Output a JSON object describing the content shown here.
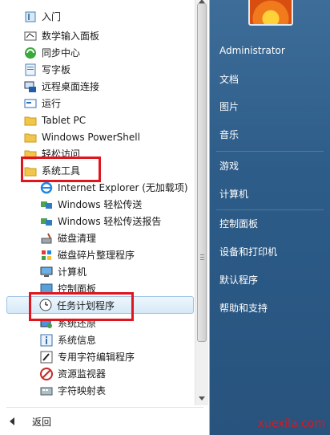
{
  "programs": [
    {
      "label": "入门",
      "icon": "getting-started-icon"
    },
    {
      "label": "数学输入面板",
      "icon": "math-input-icon"
    },
    {
      "label": "同步中心",
      "icon": "sync-center-icon"
    },
    {
      "label": "写字板",
      "icon": "wordpad-icon"
    },
    {
      "label": "远程桌面连接",
      "icon": "remote-desktop-icon"
    },
    {
      "label": "运行",
      "icon": "run-icon"
    },
    {
      "label": "Tablet PC",
      "icon": "folder-icon"
    },
    {
      "label": "Windows PowerShell",
      "icon": "folder-icon"
    },
    {
      "label": "轻松访问",
      "icon": "folder-icon"
    },
    {
      "label": "系统工具",
      "icon": "folder-icon"
    },
    {
      "label": "Internet Explorer (无加载项)",
      "icon": "internet-explorer-icon"
    },
    {
      "label": "Windows 轻松传送",
      "icon": "easy-transfer-icon"
    },
    {
      "label": "Windows 轻松传送报告",
      "icon": "easy-transfer-report-icon"
    },
    {
      "label": "磁盘清理",
      "icon": "disk-cleanup-icon"
    },
    {
      "label": "磁盘碎片整理程序",
      "icon": "defragmenter-icon"
    },
    {
      "label": "计算机",
      "icon": "computer-icon"
    },
    {
      "label": "控制面板",
      "icon": "control-panel-icon"
    },
    {
      "label": "任务计划程序",
      "icon": "clock-icon"
    },
    {
      "label": "系统还原",
      "icon": "system-restore-icon"
    },
    {
      "label": "系统信息",
      "icon": "system-info-icon"
    },
    {
      "label": "专用字符编辑程序",
      "icon": "char-editor-icon"
    },
    {
      "label": "资源监视器",
      "icon": "resource-monitor-icon"
    },
    {
      "label": "字符映射表",
      "icon": "char-map-icon"
    }
  ],
  "back_label": "返回",
  "right": {
    "user": "Administrator",
    "items": [
      "文档",
      "图片",
      "音乐",
      "游戏",
      "计算机",
      "控制面板",
      "设备和打印机",
      "默认程序",
      "帮助和支持"
    ]
  },
  "watermark": "xuexila.com",
  "colors": {
    "highlight_box": "#e0161e",
    "panel": "#2d5c89"
  }
}
